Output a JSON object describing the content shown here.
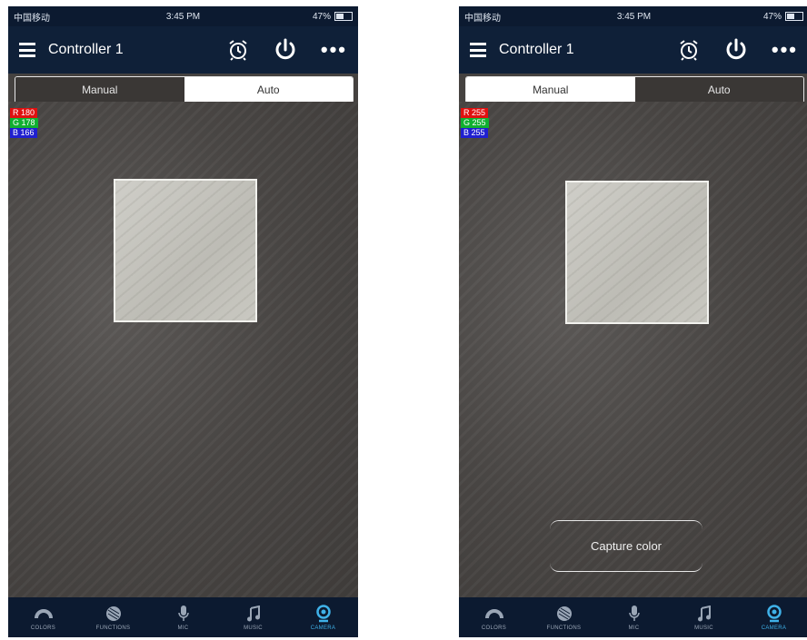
{
  "status": {
    "carrier": "中国移动",
    "time": "3:45 PM",
    "battery": "47%"
  },
  "header": {
    "title": "Controller 1"
  },
  "tabs": {
    "manual": "Manual",
    "auto": "Auto"
  },
  "left": {
    "readout": {
      "r": "R 180",
      "g": "G 178",
      "b": "B 166"
    }
  },
  "right": {
    "readout": {
      "r": "R 255",
      "g": "G 255",
      "b": "B 255"
    },
    "capture_label": "Capture color"
  },
  "bottom_nav": {
    "colors": "COLORS",
    "functions": "FUNCTIONS",
    "mic": "MIC",
    "music": "MUSIC",
    "camera": "CAMERA"
  },
  "colors": {
    "header_bg": "#0f2038",
    "accent": "#3fb1e8"
  }
}
